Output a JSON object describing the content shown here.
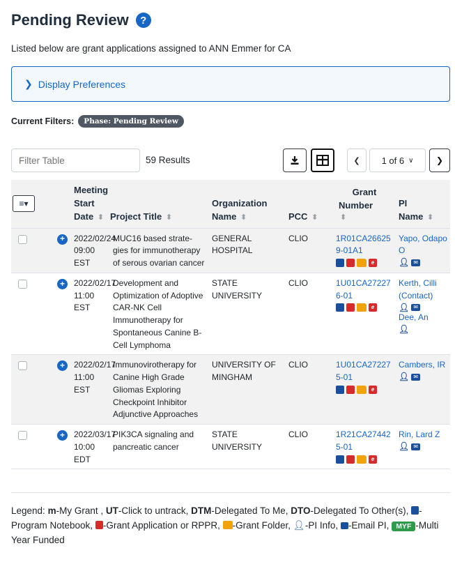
{
  "page": {
    "title": "Pending Review",
    "subtitle": "Listed below are grant applications assigned to ANN Emmer for CA",
    "display_preferences": "Display Preferences",
    "current_filters_label": "Current Filters:",
    "filter_badge": "Phase: Pending Review"
  },
  "toolbar": {
    "filter_placeholder": "Filter Table",
    "results": "59 Results",
    "pager": "1 of 6"
  },
  "table": {
    "headers": {
      "meeting": "Meeting",
      "start": "Start",
      "date": "Date",
      "project_title": "Project Title",
      "organization": "Organization",
      "name": "Name",
      "pcc": "PCC",
      "grant": "Grant",
      "number": "Number",
      "pi": "PI",
      "pi_name": "Name"
    },
    "rows": [
      {
        "date": "2022/02/24",
        "time": "09:00 EST",
        "title": "MUC16 based strate-gies for immunotherapy of serous ovarian cancer",
        "org": "GENERAL HOSPITAL",
        "pcc": "CLIO",
        "grant": "1R01CA266259-01A1",
        "pi": "Yapo, Odapo O",
        "pi2": ""
      },
      {
        "date": "2022/02/17",
        "time": "11:00 EST",
        "title": "Development and Optimization of Adoptive CAR-NK Cell Immunotherapy for Spontaneous Canine B-Cell Lymphoma",
        "org": "STATE UNIVERSITY",
        "pcc": "CLIO",
        "grant": "1U01CA272276-01",
        "pi": "Kerth, Cilli (Contact)",
        "pi2": "Dee, An"
      },
      {
        "date": "2022/02/17",
        "time": "11:00 EST",
        "title": "Immunovirotherapy for Canine High Grade Gliomas Exploring Checkpoint Inhibitor Adjunctive Approaches",
        "org": "UNIVERSITY OF MINGHAM",
        "pcc": "CLIO",
        "grant": "1U01CA272275-01",
        "pi": "Cambers, IR",
        "pi2": ""
      },
      {
        "date": "2022/03/17",
        "time": "10:00 EDT",
        "title": "PIK3CA signaling and pancreatic cancer",
        "org": "STATE UNIVERSITY",
        "pcc": "CLIO",
        "grant": "1R21CA274425-01",
        "pi": "Rin, Lard Z",
        "pi2": ""
      }
    ]
  },
  "legend": {
    "label": "Legend:",
    "m": "m",
    "m_text": "-My Grant ,",
    "ut": "UT",
    "ut_text": "-Click to untrack,",
    "dtm": "DTM",
    "dtm_text": "-Delegated To Me,",
    "dto": "DTO",
    "dto_text": "-Delegated To Other(s),",
    "nb_text": "-Program Notebook,",
    "pdf_text": "-Grant Application or RPPR,",
    "folder_text": "-Grant Folder,",
    "pi_text": "-PI Info,",
    "mail_text": "-Email PI,",
    "myf": "MYF",
    "myf_text": "-Multi Year Funded"
  },
  "colors": {
    "primary": "#1666c5",
    "badge": "#4f5862",
    "pdf_red": "#d62b2b",
    "folder": "#f0a30a",
    "myf_green": "#2e9a4a"
  }
}
